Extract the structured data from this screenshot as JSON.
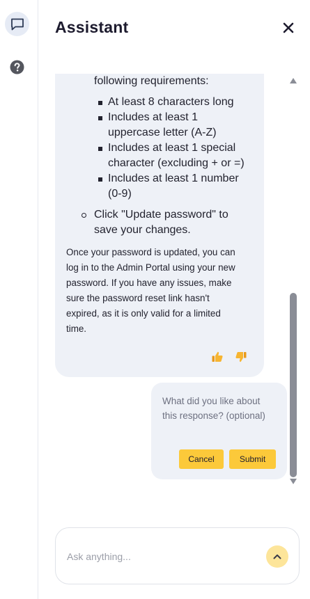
{
  "rail": {
    "chat_icon": "chat-bubble-icon",
    "help_icon": "help-circle-icon"
  },
  "header": {
    "title": "Assistant",
    "close_icon": "close-icon"
  },
  "message": {
    "intro_line": "following requirements:",
    "requirements": [
      [
        "At least 8 characters long"
      ],
      [
        "Includes at least 1",
        "uppercase letter (A-Z)"
      ],
      [
        "Includes at least 1 special",
        "character (excluding + or =)"
      ],
      [
        "Includes at least 1 number",
        "(0-9)"
      ]
    ],
    "step": [
      "Click \"Update password\" to",
      "save your changes."
    ],
    "paragraph": [
      "Once your password is updated, you can",
      "log in to the Admin Portal using your new",
      "password. If you have any issues, make",
      "sure the password reset link hasn't",
      "expired, as it is only valid for a limited",
      "time."
    ],
    "thumbs_up_icon": "thumbs-up-icon",
    "thumbs_down_icon": "thumbs-down-icon"
  },
  "feedback": {
    "placeholder_lines": [
      "What did you like about",
      "this response? (optional)"
    ],
    "cancel_label": "Cancel",
    "submit_label": "Submit"
  },
  "composer": {
    "placeholder": "Ask anything...",
    "send_icon": "chevron-up-icon"
  },
  "colors": {
    "accent": "#fcc93a",
    "bubble_bg": "#eef1f7",
    "send_bg": "#fde59a"
  }
}
